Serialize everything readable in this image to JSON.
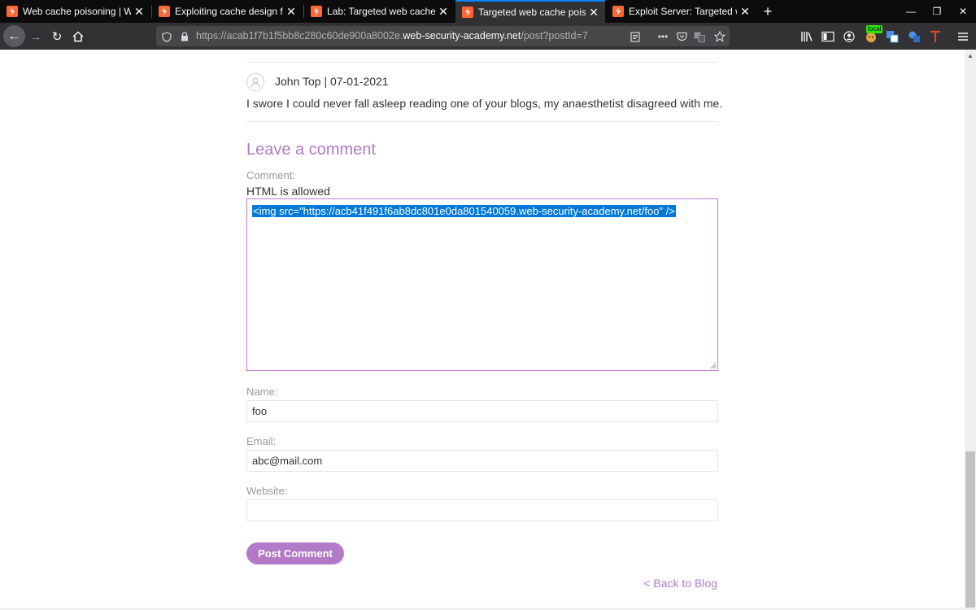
{
  "browser": {
    "tabs": [
      {
        "title": "Web cache poisoning | Web Se",
        "active": false
      },
      {
        "title": "Exploiting cache design flaws |",
        "active": false
      },
      {
        "title": "Lab: Targeted web cache poiso",
        "active": false
      },
      {
        "title": "Targeted web cache poisoning",
        "active": true
      },
      {
        "title": "Exploit Server: Targeted web ca",
        "active": false
      }
    ],
    "close_glyph": "✕",
    "new_tab_glyph": "+",
    "url_prefix": "https://acab1f7b1f5bb8c280c60de900a8002e.",
    "url_domain": "web-security-academy.net",
    "url_path": "/post?postId=7",
    "local_badge": "local",
    "accent_color": "#0a84ff"
  },
  "comment": {
    "author_line": "John Top | 07-01-2021",
    "body": "I swore I could never fall asleep reading one of your blogs, my anaesthetist disagreed with me."
  },
  "form": {
    "title": "Leave a comment",
    "comment_label": "Comment:",
    "html_hint": "HTML is allowed",
    "comment_value": "<img src=\"https://acb41f491f6ab8dc801e0da801540059.web-security-academy.net/foo\" />",
    "name_label": "Name:",
    "name_value": "foo",
    "email_label": "Email:",
    "email_value": "abc@mail.com",
    "website_label": "Website:",
    "website_value": "",
    "submit_label": "Post Comment",
    "back_link": "< Back to Blog",
    "accent_color": "#b27ac7"
  }
}
